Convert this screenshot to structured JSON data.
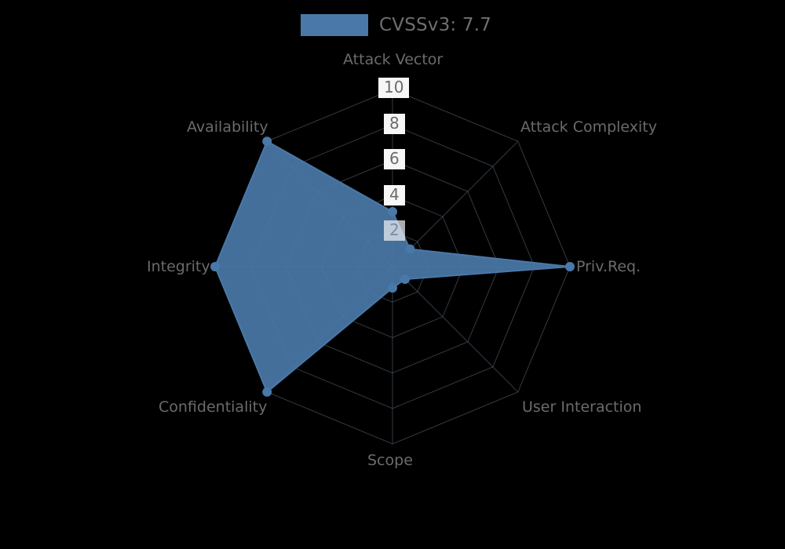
{
  "legend": {
    "label": "CVSSv3: 7.7",
    "swatch_color": "#4a78a8",
    "swatch_name": "cvssv3-series-swatch"
  },
  "axis_labels": {
    "attack_vector": "Attack Vector",
    "attack_complexity": "Attack Complexity",
    "privileges_required": "Priv.Req.",
    "user_interaction": "User Interaction",
    "scope": "Scope",
    "confidentiality": "Confidentiality",
    "integrity": "Integrity",
    "availability": "Availability"
  },
  "radial_ticks": {
    "t10": "10",
    "t8": "8",
    "t6": "6",
    "t4": "4",
    "t2": "2"
  },
  "colors": {
    "background": "#000000",
    "series_fill": "#4a78a8",
    "grid": "#5d6a78",
    "text": "#6b6b6b",
    "tick_bg": "#f7f7f7"
  },
  "chart_data": {
    "type": "radar",
    "title": "",
    "subtitle": "",
    "xlabel": "",
    "ylabel": "",
    "grid": true,
    "legend_position": "top-center",
    "rlim": [
      0,
      10
    ],
    "rticks": [
      2,
      4,
      6,
      8,
      10
    ],
    "categories": [
      "Attack Vector",
      "Attack Complexity",
      "Priv.Req.",
      "User Interaction",
      "Scope",
      "Confidentiality",
      "Integrity",
      "Availability"
    ],
    "series": [
      {
        "name": "CVSSv3: 7.7",
        "color": "#4a78a8",
        "values": [
          3.1,
          1.4,
          10.0,
          1.0,
          1.2,
          10.0,
          10.0,
          10.0
        ]
      }
    ],
    "annotations": [
      "CVSSv3: 7.7"
    ]
  }
}
